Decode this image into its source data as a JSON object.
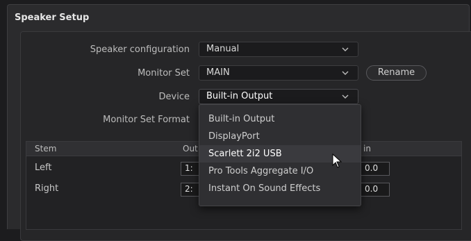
{
  "panel": {
    "title": "Speaker Setup"
  },
  "form": {
    "speaker_config": {
      "label": "Speaker configuration",
      "value": "Manual"
    },
    "monitor_set": {
      "label": "Monitor Set",
      "value": "MAIN",
      "rename_label": "Rename"
    },
    "device": {
      "label": "Device",
      "value": "Built-in Output"
    },
    "monitor_set_format": {
      "label": "Monitor Set Format"
    }
  },
  "table": {
    "headers": [
      "Stem",
      "Out",
      "in"
    ],
    "rows": [
      {
        "stem": "Left",
        "out": "1:",
        "gain": "0.0"
      },
      {
        "stem": "Right",
        "out": "2:",
        "gain": "0.0"
      }
    ]
  },
  "device_dropdown": {
    "options": [
      "Built-in Output",
      "DisplayPort",
      "Scarlett 2i2 USB",
      "Pro Tools Aggregate I/O",
      "Instant On Sound Effects"
    ],
    "highlighted_index": 2
  }
}
